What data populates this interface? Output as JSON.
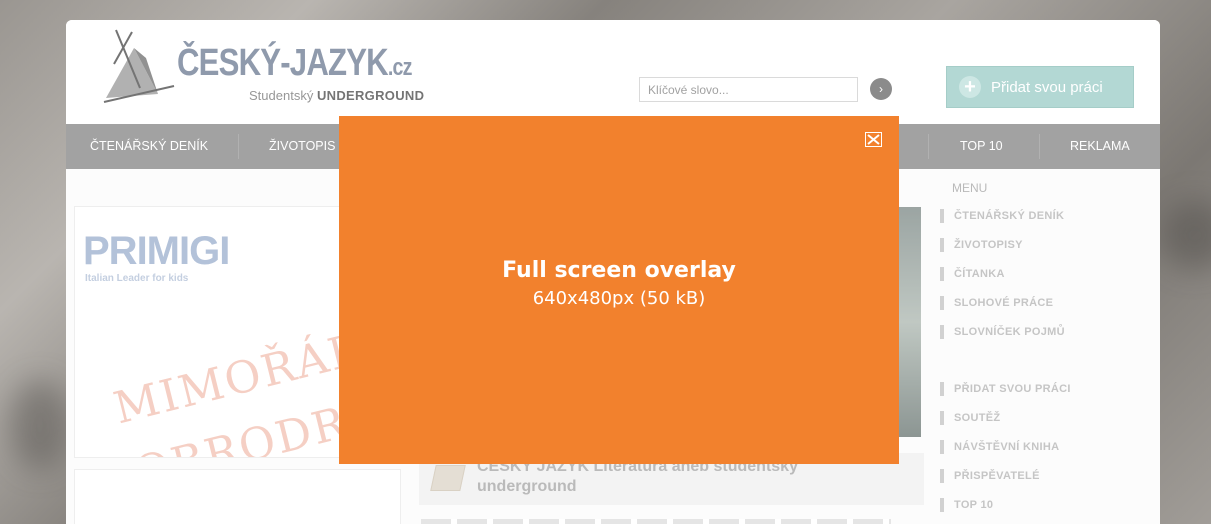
{
  "site": {
    "logo_title": "ČESKÝ-JAZYK",
    "logo_tld": ".cz",
    "logo_sub_regular": "Studentský",
    "logo_sub_bold": "UNDERGROUND",
    "logo_icon": "book-quill-icon"
  },
  "search": {
    "placeholder": "Klíčové slovo..."
  },
  "add_button": {
    "label": "Přidat svou práci"
  },
  "nav": {
    "items": [
      "ČTENÁŘSKÝ DENÍK",
      "ŽIVOTOPIS",
      "TOP 10",
      "REKLAMA"
    ]
  },
  "ad": {
    "brand": "PRIMIGI",
    "tagline": "Italian Leader for kids",
    "headline_1": "MIMOŘÁDNÉ",
    "headline_2": "DOBRODRUŽST"
  },
  "article": {
    "title": "ČESKÝ JAZYK Literatura aneb studentský underground"
  },
  "sidebar": {
    "title": "MENU",
    "group1": [
      "ČTENÁŘSKÝ DENÍK",
      "ŽIVOTOPISY",
      "ČÍTANKA",
      "SLOHOVÉ PRÁCE",
      "SLOVNÍČEK POJMŮ"
    ],
    "group2": [
      "PŘIDAT SVOU PRÁCI",
      "SOUTĚŽ",
      "NÁVŠTĚVNÍ KNIHA",
      "PŘISPĚVATELÉ",
      "TOP 10"
    ]
  },
  "overlay": {
    "title": "Full screen overlay",
    "subtitle": "640x480px (50 kB)",
    "color": "#f2812d",
    "close_icon": "close-icon"
  }
}
